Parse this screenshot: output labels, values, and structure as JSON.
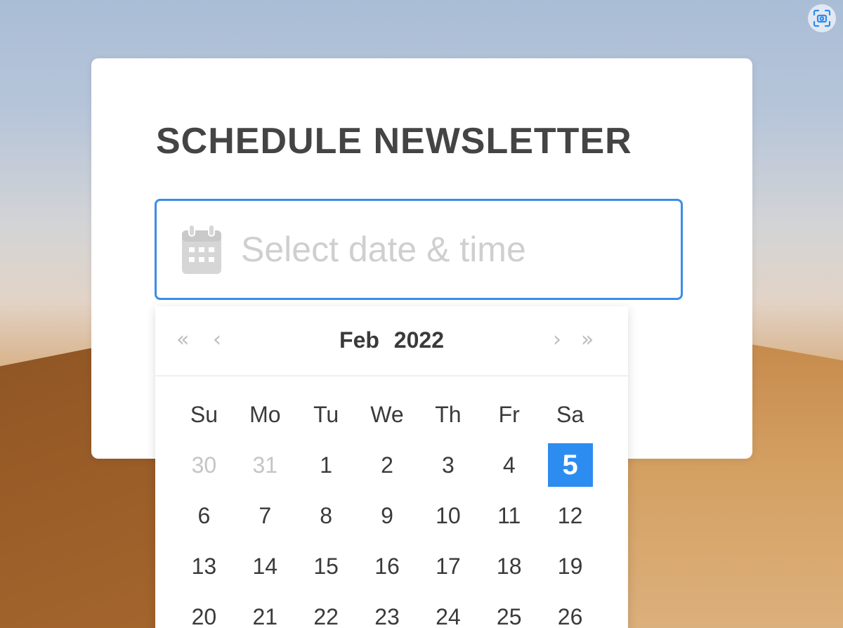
{
  "title": "SCHEDULE NEWSLETTER",
  "date_input": {
    "placeholder": "Select date & time",
    "value": ""
  },
  "picker": {
    "month": "Feb",
    "year": "2022",
    "nav": {
      "prev_year": "«",
      "prev_month": "‹",
      "next_month": "›",
      "next_year": "»"
    },
    "weekdays": [
      "Su",
      "Mo",
      "Tu",
      "We",
      "Th",
      "Fr",
      "Sa"
    ],
    "weeks": [
      [
        {
          "d": "30",
          "muted": true
        },
        {
          "d": "31",
          "muted": true
        },
        {
          "d": "1"
        },
        {
          "d": "2"
        },
        {
          "d": "3"
        },
        {
          "d": "4"
        },
        {
          "d": "5",
          "selected": true
        }
      ],
      [
        {
          "d": "6"
        },
        {
          "d": "7"
        },
        {
          "d": "8"
        },
        {
          "d": "9"
        },
        {
          "d": "10"
        },
        {
          "d": "11"
        },
        {
          "d": "12"
        }
      ],
      [
        {
          "d": "13"
        },
        {
          "d": "14"
        },
        {
          "d": "15"
        },
        {
          "d": "16"
        },
        {
          "d": "17"
        },
        {
          "d": "18"
        },
        {
          "d": "19"
        }
      ],
      [
        {
          "d": "20"
        },
        {
          "d": "21"
        },
        {
          "d": "22"
        },
        {
          "d": "23"
        },
        {
          "d": "24"
        },
        {
          "d": "25"
        },
        {
          "d": "26"
        }
      ]
    ],
    "selected_color": "#2d8cf0"
  },
  "colors": {
    "accent": "#3b8de6",
    "title": "#444444",
    "muted_day": "#c5c5c5"
  },
  "icons": {
    "screenshot": "screenshot-icon",
    "calendar": "calendar-icon"
  }
}
